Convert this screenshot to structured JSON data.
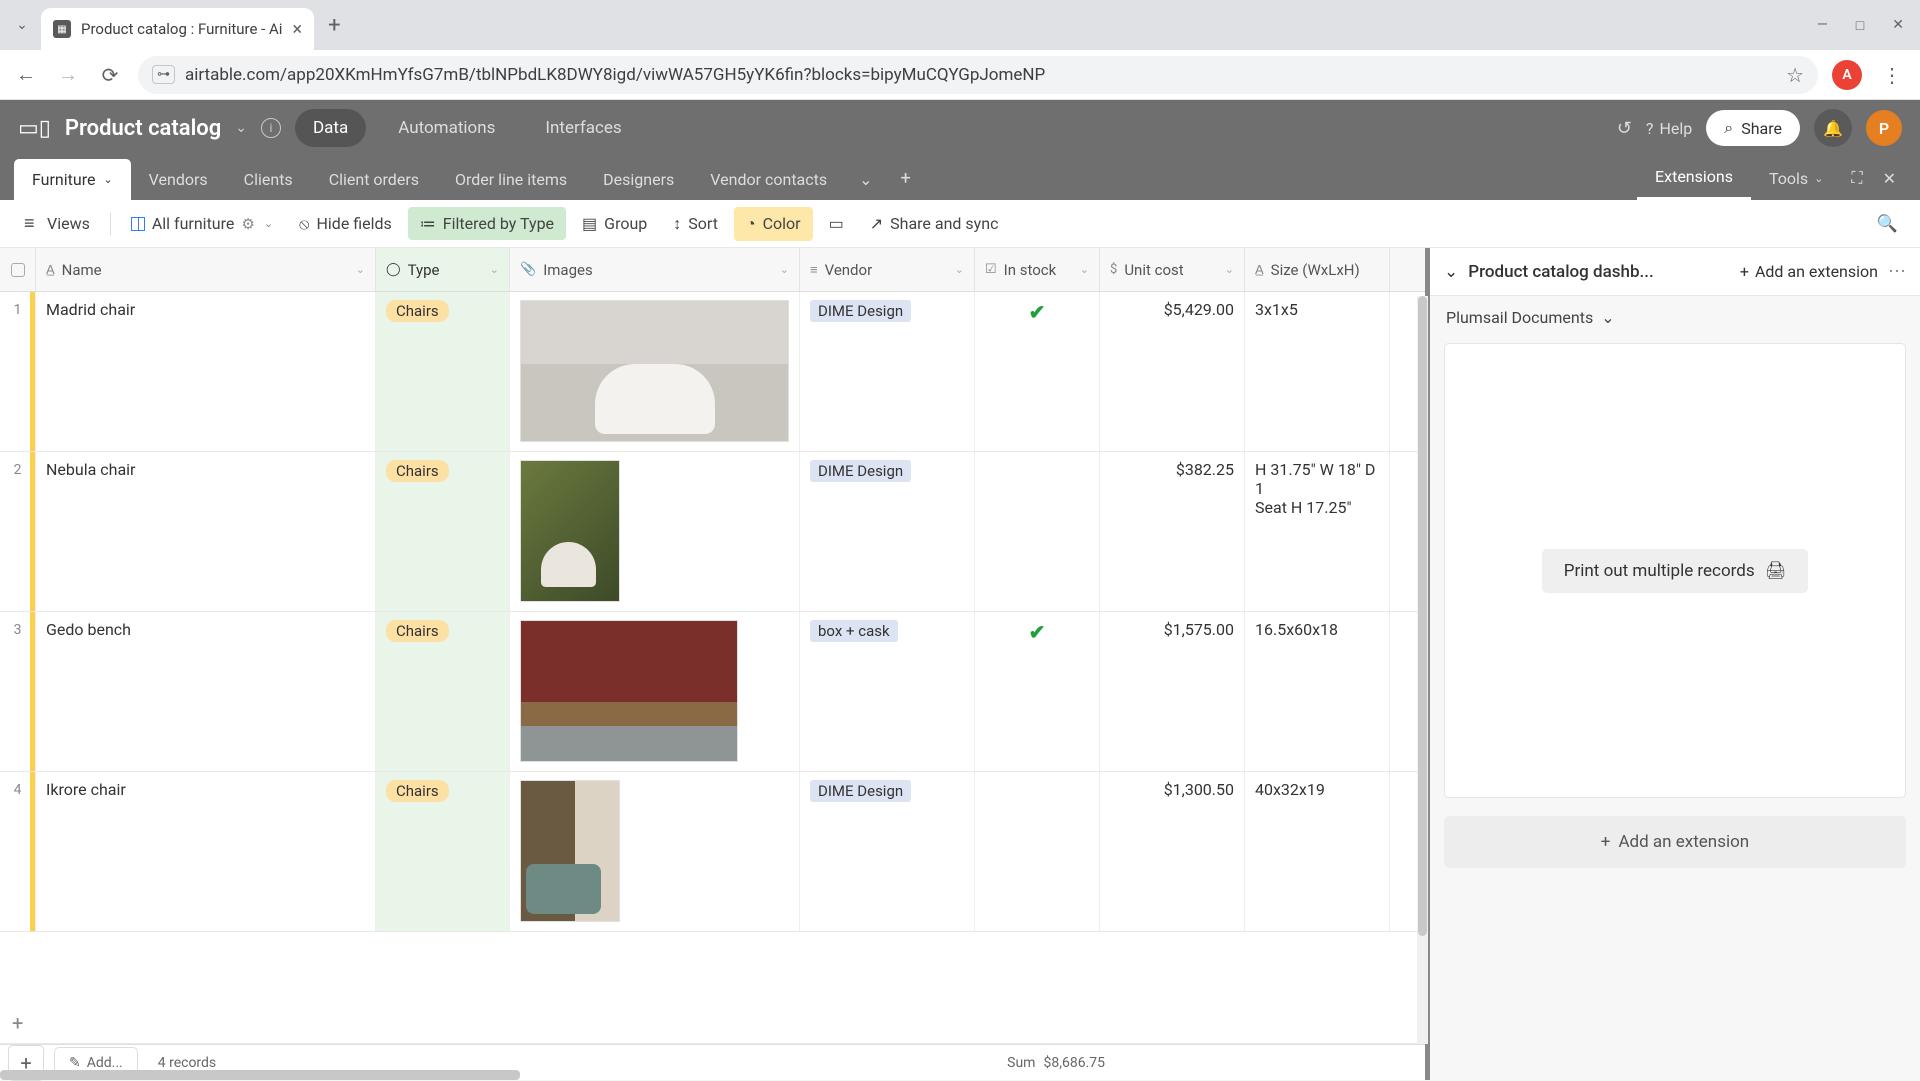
{
  "browser": {
    "tab_title": "Product catalog : Furniture - Ai",
    "url": "airtable.com/app20XKmHmYfsG7mB/tblNPbdLK8DWY8igd/viwWA57GH5yYK6fin?blocks=bipyMuCQYGpJomeNP",
    "avatar_letter": "A"
  },
  "app": {
    "title": "Product catalog",
    "nav": {
      "data": "Data",
      "automations": "Automations",
      "interfaces": "Interfaces"
    },
    "help": "Help",
    "share": "Share",
    "avatar_letter": "P"
  },
  "tables": [
    "Furniture",
    "Vendors",
    "Clients",
    "Client orders",
    "Order line items",
    "Designers",
    "Vendor contacts"
  ],
  "ext_tabs": {
    "extensions": "Extensions",
    "tools": "Tools"
  },
  "toolbar": {
    "views": "Views",
    "view_name": "All furniture",
    "hide": "Hide fields",
    "filter": "Filtered by Type",
    "group": "Group",
    "sort": "Sort",
    "color": "Color",
    "share": "Share and sync"
  },
  "columns": {
    "name": "Name",
    "type": "Type",
    "images": "Images",
    "vendor": "Vendor",
    "in_stock": "In stock",
    "unit_cost": "Unit cost",
    "size": "Size (WxLxH)"
  },
  "rows": [
    {
      "n": "1",
      "name": "Madrid chair",
      "type": "Chairs",
      "vendor": "DIME Design",
      "stock": true,
      "cost": "$5,429.00",
      "size": "3x1x5",
      "img": "img1"
    },
    {
      "n": "2",
      "name": "Nebula chair",
      "type": "Chairs",
      "vendor": "DIME Design",
      "stock": false,
      "cost": "$382.25",
      "size": "H 31.75\" W 18\" D 1\nSeat H 17.25\"",
      "img": "img2"
    },
    {
      "n": "3",
      "name": "Gedo bench",
      "type": "Chairs",
      "vendor": "box + cask",
      "stock": true,
      "cost": "$1,575.00",
      "size": "16.5x60x18",
      "img": "img3"
    },
    {
      "n": "4",
      "name": "Ikrore chair",
      "type": "Chairs",
      "vendor": "DIME Design",
      "stock": false,
      "cost": "$1,300.50",
      "size": "40x32x19",
      "img": "img4"
    }
  ],
  "footer": {
    "add": "Add...",
    "records": "4 records",
    "sum_label": "Sum",
    "sum_value": "$8,686.75"
  },
  "ext_panel": {
    "title": "Product catalog dashb...",
    "add": "Add an extension",
    "plumsail": "Plumsail Documents",
    "print": "Print out multiple records",
    "add_big": "Add an extension"
  }
}
